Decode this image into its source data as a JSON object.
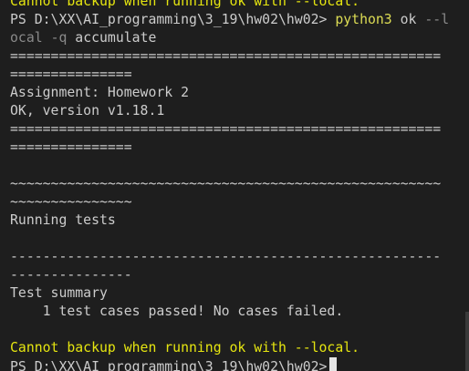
{
  "terminal": {
    "lines": [
      {
        "kind": "warn",
        "text": "Cannot backup when running ok with --local."
      },
      {
        "kind": "cmd",
        "prompt": "PS D:\\XX\\AI_programming\\3_19\\hw02\\hw02> ",
        "command": "python3",
        "space1": " ",
        "program": "ok",
        "space2": " ",
        "flag_part1": "--l"
      },
      {
        "kind": "cmd2",
        "flag_part2": "ocal",
        "space": " ",
        "flag2": "-q",
        "rest": " accumulate"
      },
      {
        "kind": "text",
        "text": "====================================================="
      },
      {
        "kind": "text",
        "text": "==============="
      },
      {
        "kind": "text",
        "text": "Assignment: Homework 2"
      },
      {
        "kind": "text",
        "text": "OK, version v1.18.1"
      },
      {
        "kind": "text",
        "text": "====================================================="
      },
      {
        "kind": "text",
        "text": "==============="
      },
      {
        "kind": "text",
        "text": ""
      },
      {
        "kind": "text",
        "text": "~~~~~~~~~~~~~~~~~~~~~~~~~~~~~~~~~~~~~~~~~~~~~~~~~~~~~"
      },
      {
        "kind": "text",
        "text": "~~~~~~~~~~~~~~~"
      },
      {
        "kind": "text",
        "text": "Running tests"
      },
      {
        "kind": "text",
        "text": ""
      },
      {
        "kind": "text",
        "text": "-----------------------------------------------------"
      },
      {
        "kind": "text",
        "text": "---------------"
      },
      {
        "kind": "text",
        "text": "Test summary"
      },
      {
        "kind": "text",
        "text": "    1 test cases passed! No cases failed."
      },
      {
        "kind": "text",
        "text": ""
      },
      {
        "kind": "warn",
        "text": "Cannot backup when running ok with --local."
      },
      {
        "kind": "prompt",
        "text": "PS D:\\XX\\AI_programming\\3_19\\hw02\\hw02>"
      }
    ]
  }
}
